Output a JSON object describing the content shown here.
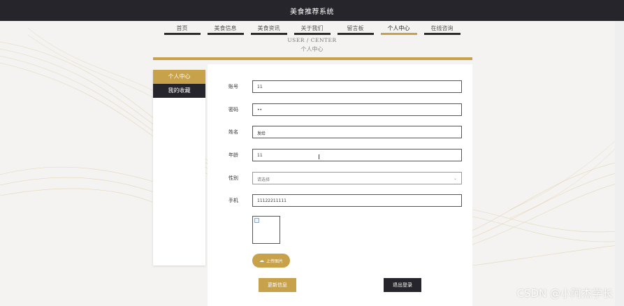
{
  "app": {
    "title": "美食推荐系统"
  },
  "nav": {
    "items": [
      {
        "label": "首页"
      },
      {
        "label": "美食信息"
      },
      {
        "label": "美食资讯"
      },
      {
        "label": "关于我们"
      },
      {
        "label": "留言板"
      },
      {
        "label": "个人中心",
        "active": true
      },
      {
        "label": "在线咨询"
      }
    ]
  },
  "breadcrumb": {
    "en": "USER / CENTER",
    "cn": "个人中心"
  },
  "sidebar": {
    "items": [
      {
        "label": "个人中心",
        "active": true
      },
      {
        "label": "我的收藏"
      }
    ]
  },
  "form": {
    "fields": [
      {
        "label": "账号",
        "value": "11"
      },
      {
        "label": "密码",
        "value": "••"
      },
      {
        "label": "姓名",
        "value": "发给"
      },
      {
        "label": "年龄",
        "value": "11"
      },
      {
        "label": "性别",
        "placeholder": "请选择",
        "type": "select"
      },
      {
        "label": "手机",
        "value": "11122211111"
      }
    ],
    "upload_label": "上传图片",
    "update_label": "更新信息",
    "logout_label": "退出登录"
  },
  "icons": {
    "upload": "cloud-upload-icon",
    "select": "chevron-down-icon",
    "image": "broken-image-icon"
  },
  "colors": {
    "accent": "#c8a24a",
    "dark": "#25252b"
  },
  "watermark": "CSDN @小阿杰学长"
}
